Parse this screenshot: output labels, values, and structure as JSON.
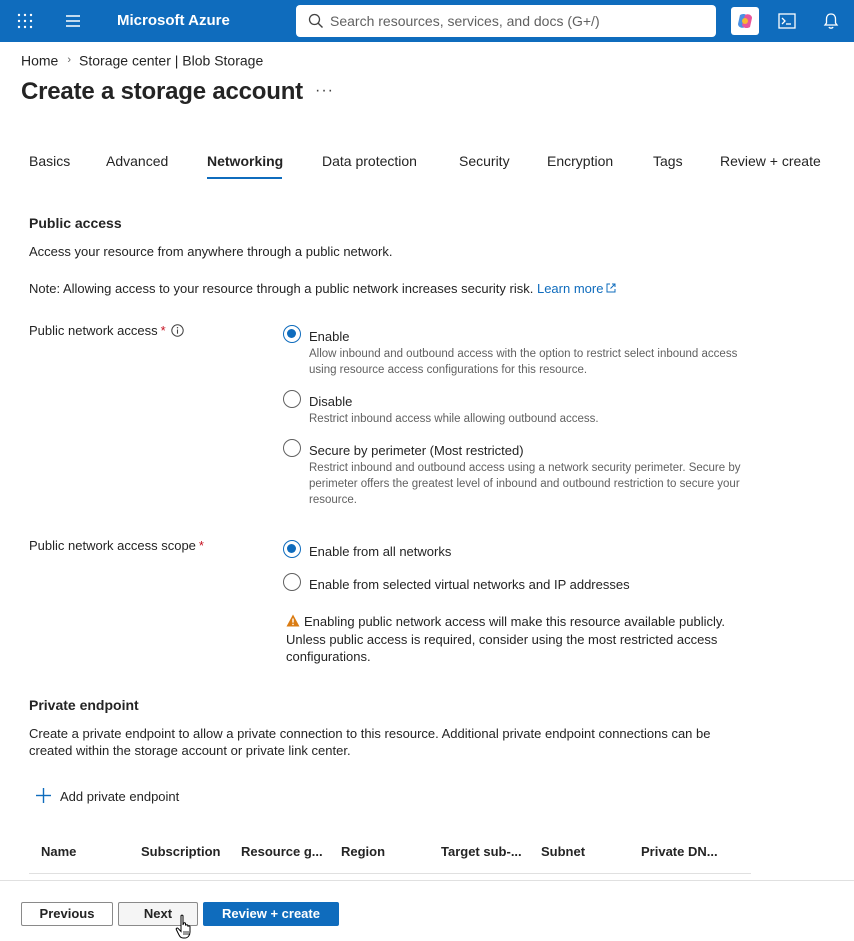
{
  "topbar": {
    "brand": "Microsoft Azure",
    "search_placeholder": "Search resources, services, and docs (G+/)",
    "accent": "#0f6cbd"
  },
  "breadcrumb": {
    "items": [
      "Home",
      "Storage center | Blob Storage"
    ]
  },
  "page": {
    "title": "Create a storage account",
    "more_label": "···"
  },
  "tabs": [
    "Basics",
    "Advanced",
    "Networking",
    "Data protection",
    "Security",
    "Encryption",
    "Tags",
    "Review + create"
  ],
  "active_tab": "Networking",
  "public_access": {
    "title": "Public access",
    "description": "Access your resource from anywhere through a public network.",
    "note": "Note: Allowing access to your resource through a public network increases security risk.",
    "learn_more": "Learn more",
    "network_access": {
      "label": "Public network access",
      "required": "*",
      "options": [
        {
          "label": "Enable",
          "description": "Allow inbound and outbound access with the option to restrict select inbound access using resource access configurations for this resource.",
          "checked": true
        },
        {
          "label": "Disable",
          "description": "Restrict inbound access while allowing outbound access.",
          "checked": false
        },
        {
          "label": "Secure by perimeter (Most restricted)",
          "description": "Restrict inbound and outbound access using a network security perimeter. Secure by perimeter offers the greatest level of inbound and outbound restriction to secure your resource.",
          "checked": false
        }
      ]
    },
    "scope": {
      "label": "Public network access scope",
      "required": "*",
      "options": [
        {
          "label": "Enable from all networks",
          "checked": true
        },
        {
          "label": "Enable from selected virtual networks and IP addresses",
          "checked": false
        }
      ]
    },
    "warning": "Enabling public network access will make this resource available publicly. Unless public access is required, consider using the most restricted access configurations."
  },
  "private_endpoint": {
    "title": "Private endpoint",
    "description": "Create a private endpoint to allow a private connection to this resource. Additional private endpoint connections can be created within the storage account or private link center.",
    "add_label": "Add private endpoint",
    "columns": [
      "Name",
      "Subscription",
      "Resource g...",
      "Region",
      "Target sub-...",
      "Subnet",
      "Private DN..."
    ]
  },
  "footer": {
    "previous": "Previous",
    "next": "Next",
    "review": "Review + create"
  },
  "colors": {
    "primary": "#0f6cbd",
    "warning": "#da7b11",
    "required": "#c50f1f"
  }
}
